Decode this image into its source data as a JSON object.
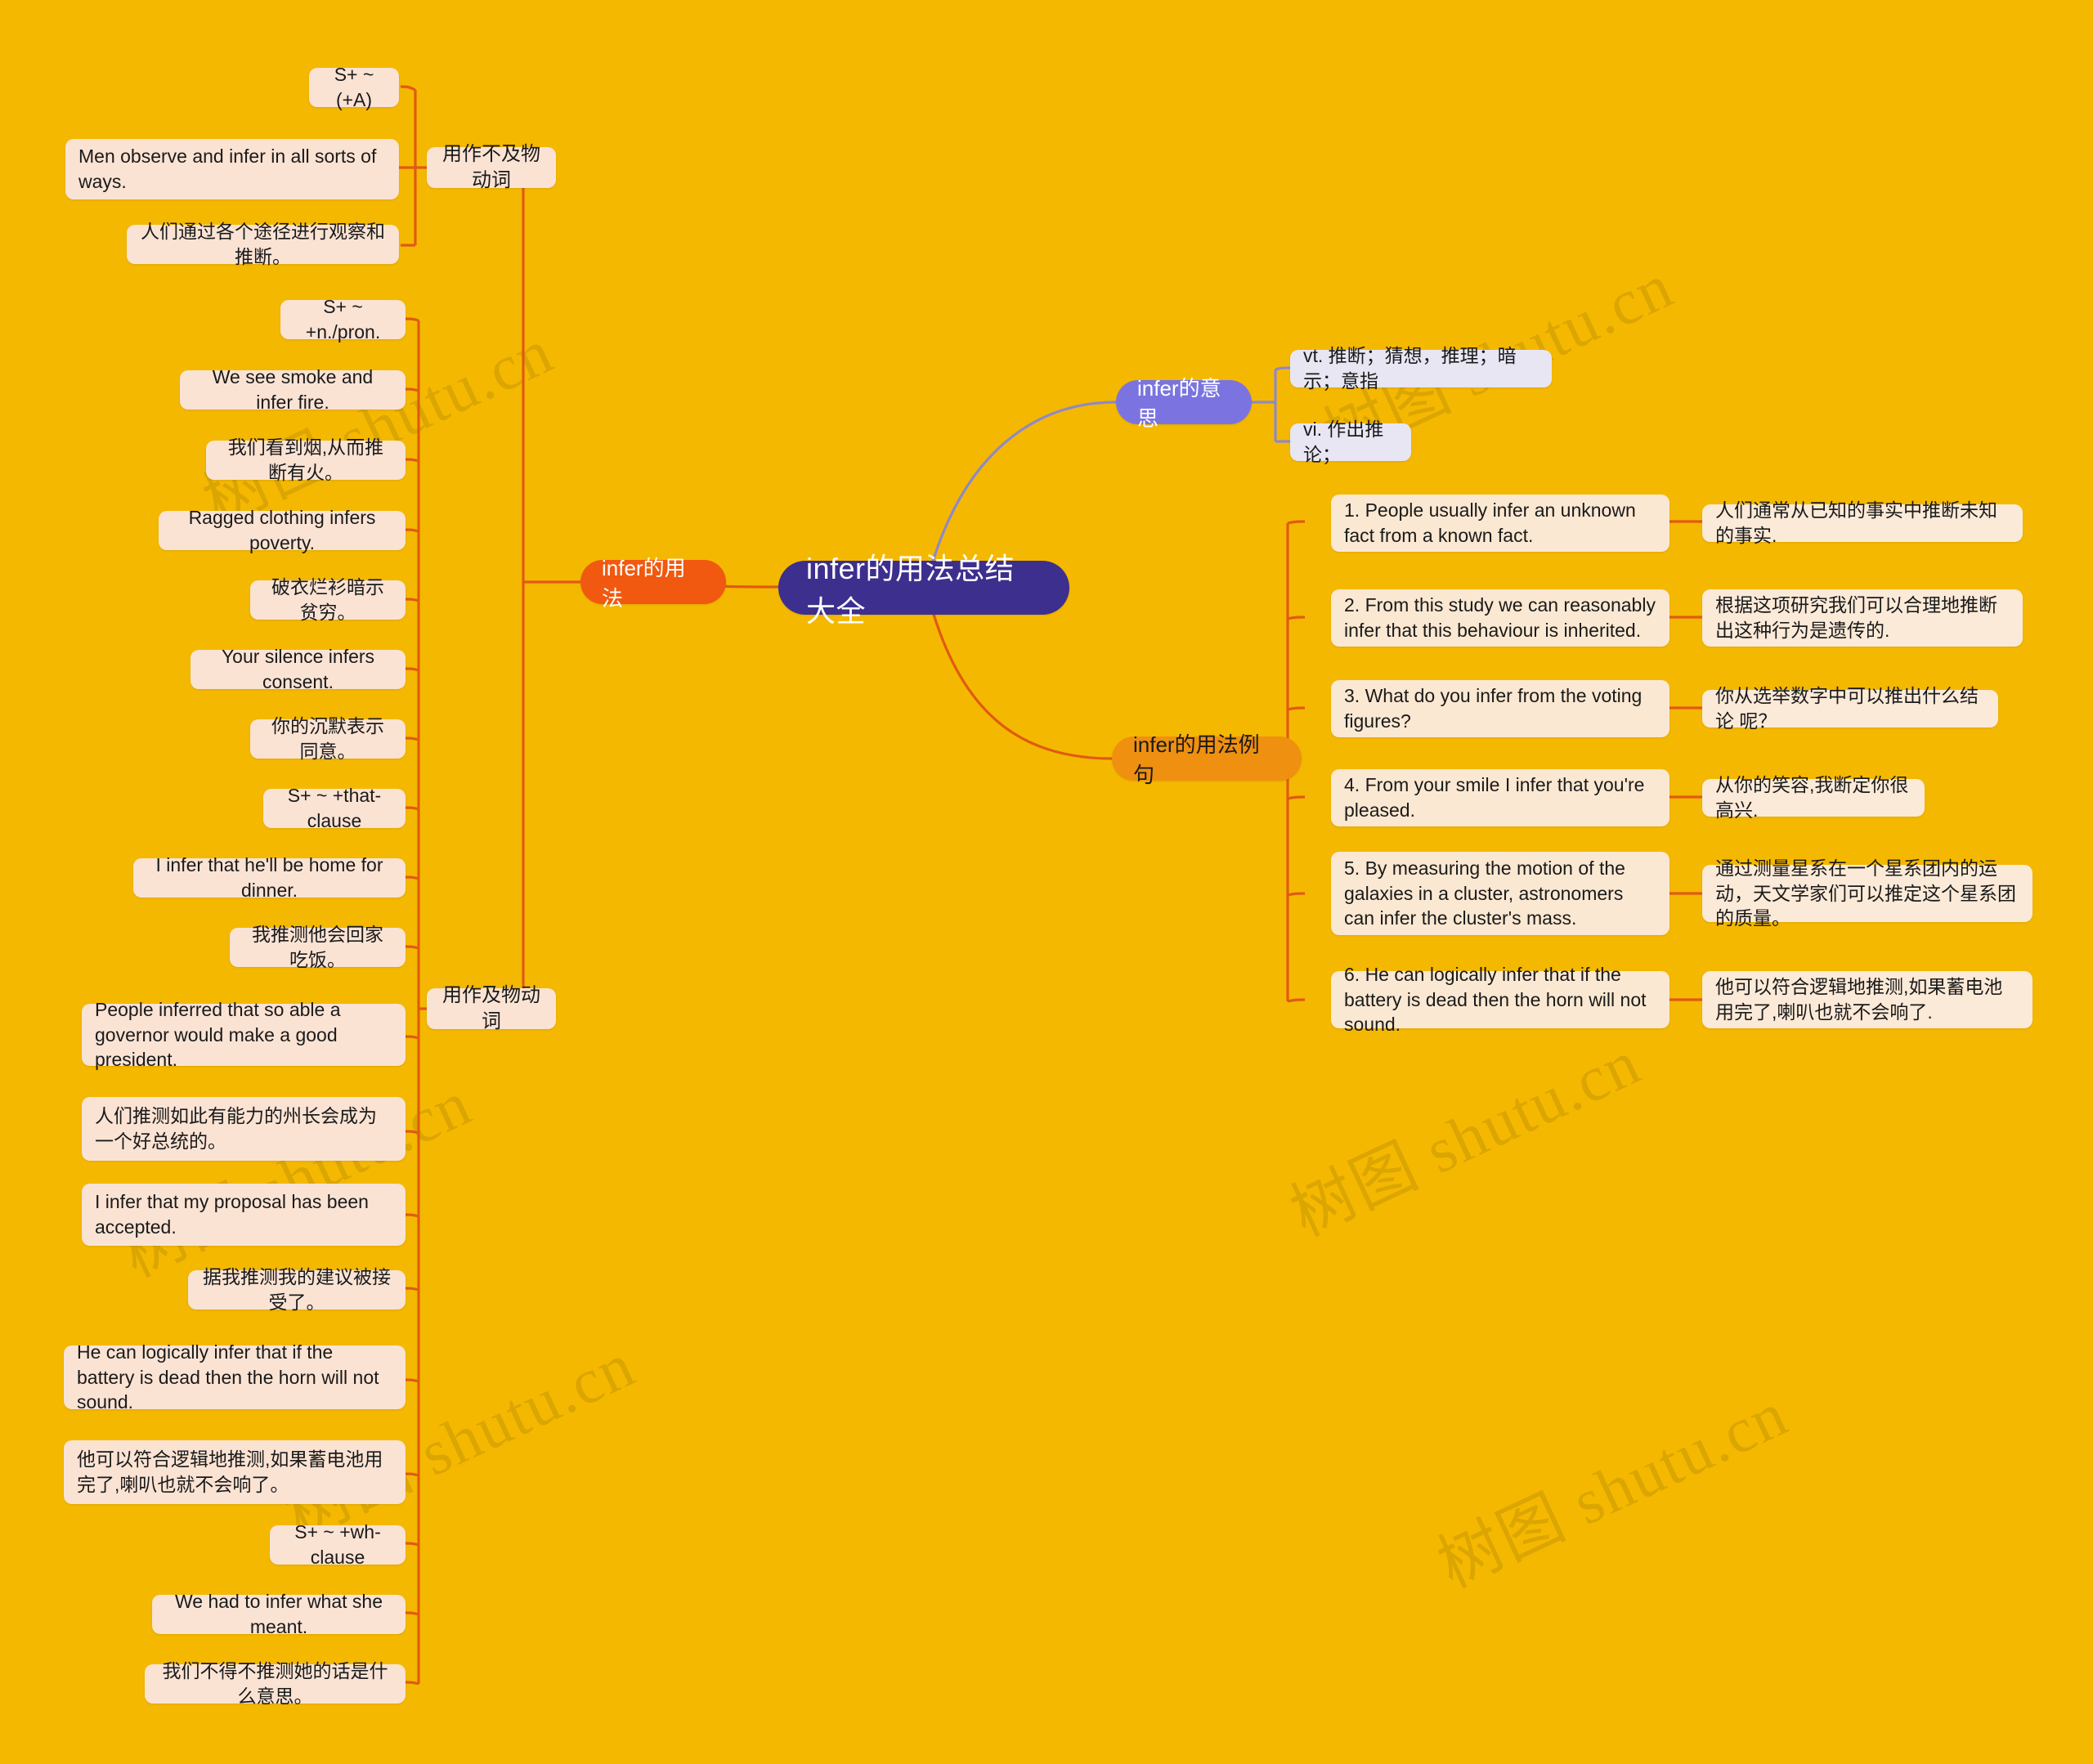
{
  "colors": {
    "background": "#f5b800",
    "root": "#3d2f8e",
    "usage_branch": "#f0590f",
    "meaning_branch": "#7b74e0",
    "examples_branch": "#ef9010",
    "leaf": "#fbe3d4",
    "leaf_lavender": "#e8e6f3",
    "leaf_cream": "#fbe8d2",
    "link_orange": "#e05a14",
    "link_purple": "#8f89c4"
  },
  "watermarks": [
    "树图 shutu.cn",
    "树图 shutu.cn",
    "树图 shutu.cn",
    "树图 shutu.cn",
    "树图 shutu.cn",
    "树图 shutu.cn"
  ],
  "root": {
    "label": "infer的用法总结大全"
  },
  "branches": {
    "usage": {
      "label": "infer的用法",
      "categories": [
        {
          "label": "用作不及物动词",
          "items": [
            {
              "text": "S+ ~ (+A)",
              "align": "right"
            },
            {
              "text": "Men observe and infer in all sorts of ways.",
              "align": "left"
            },
            {
              "text": "人们通过各个途径进行观察和推断。",
              "align": "right"
            }
          ]
        },
        {
          "label": "用作及物动词",
          "items": [
            {
              "text": "S+ ~ +n./pron.",
              "align": "right"
            },
            {
              "text": "We see smoke and infer fire.",
              "align": "center"
            },
            {
              "text": "我们看到烟,从而推断有火。",
              "align": "right"
            },
            {
              "text": "Ragged clothing infers poverty.",
              "align": "center"
            },
            {
              "text": "破衣烂衫暗示贫穷。",
              "align": "right"
            },
            {
              "text": "Your silence infers consent.",
              "align": "center"
            },
            {
              "text": "你的沉默表示同意。",
              "align": "right"
            },
            {
              "text": "S+ ~ +that-clause",
              "align": "right"
            },
            {
              "text": "I infer that he'll be home for dinner.",
              "align": "center"
            },
            {
              "text": "我推测他会回家吃饭。",
              "align": "right"
            },
            {
              "text": "People inferred that so able a governor would make a good president.",
              "align": "left"
            },
            {
              "text": "人们推测如此有能力的州长会成为一个好总统的。",
              "align": "left"
            },
            {
              "text": "I infer that my proposal has been accepted.",
              "align": "left"
            },
            {
              "text": "据我推测我的建议被接受了。",
              "align": "right"
            },
            {
              "text": "He can logically infer that if the battery is dead then the horn will not sound.",
              "align": "left"
            },
            {
              "text": "他可以符合逻辑地推测,如果蓄电池用完了,喇叭也就不会响了。",
              "align": "left"
            },
            {
              "text": "S+ ~ +wh-clause",
              "align": "right"
            },
            {
              "text": "We had to infer what she meant.",
              "align": "center"
            },
            {
              "text": "我们不得不推测她的话是什么意思。",
              "align": "right"
            }
          ]
        }
      ]
    },
    "meaning": {
      "label": "infer的意思",
      "items": [
        "vt. 推断；猜想，推理；暗示；意指",
        "vi. 作出推论；"
      ]
    },
    "examples": {
      "label": "infer的用法例句",
      "items": [
        {
          "en": "1. People usually infer an unknown fact from a known fact.",
          "zh": "人们通常从已知的事实中推断未知的事实."
        },
        {
          "en": "2. From this study we can reasonably infer that this behaviour is inherited.",
          "zh": "根据这项研究我们可以合理地推断出这种行为是遗传的."
        },
        {
          "en": "3. What do you infer from the voting figures?",
          "zh": "你从选举数字中可以推出什么结论 呢？"
        },
        {
          "en": "4. From your smile I infer that you're pleased.",
          "zh": "从你的笑容,我断定你很高兴."
        },
        {
          "en": "5. By measuring the motion of the galaxies in a cluster, astronomers can infer the cluster's mass.",
          "zh": "通过测量星系在一个星系团内的运动，天文学家们可以推定这个星系团的质量。"
        },
        {
          "en": "6. He can logically infer that if the battery is dead then the horn will not sound.",
          "zh": "他可以符合逻辑地推测,如果蓄电池用完了,喇叭也就不会响了."
        }
      ]
    }
  }
}
